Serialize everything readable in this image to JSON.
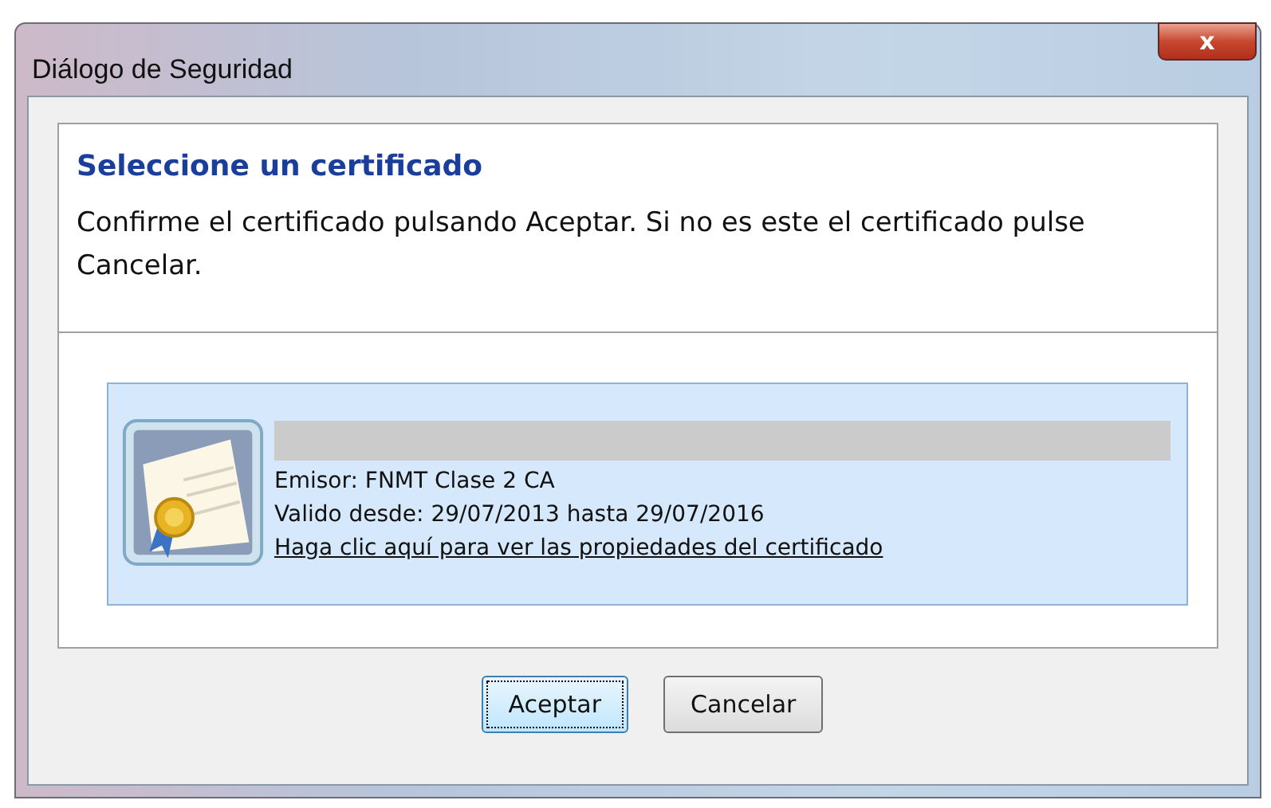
{
  "window": {
    "title": "Diálogo de Seguridad",
    "close": "x"
  },
  "heading": "Seleccione un certificado",
  "instructions": "Confirme el certificado pulsando Aceptar. Si no es este el certificado pulse Cancelar.",
  "certificate": {
    "selected": true,
    "issuer": "Emisor: FNMT Clase 2 CA",
    "validity": "Valido desde: 29/07/2013 hasta 29/07/2016",
    "link": "Haga clic aquí para ver las propiedades del certificado"
  },
  "buttons": [
    {
      "label": "Aceptar",
      "focused": true
    },
    {
      "label": "Cancelar",
      "focused": false
    }
  ]
}
